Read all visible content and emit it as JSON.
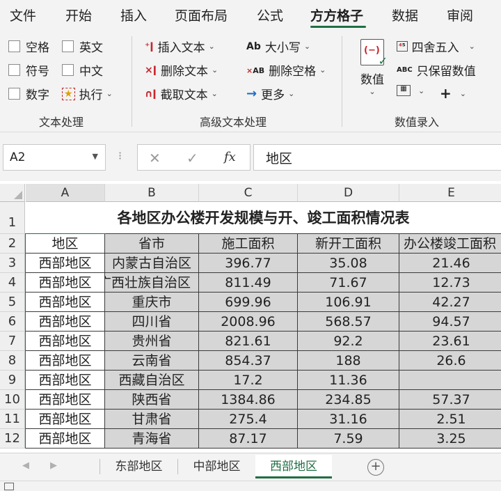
{
  "menu": {
    "tabs": [
      {
        "label": "文件"
      },
      {
        "label": "开始"
      },
      {
        "label": "插入"
      },
      {
        "label": "页面布局"
      },
      {
        "label": "公式"
      },
      {
        "label": "方方格子"
      },
      {
        "label": "数据"
      },
      {
        "label": "审阅"
      }
    ],
    "active_tab": "方方格子"
  },
  "ribbon": {
    "text_group": {
      "label": "文本处理",
      "space": "空格",
      "english": "英文",
      "symbol": "符号",
      "chinese": "中文",
      "number": "数字",
      "execute": "执行"
    },
    "adv_group": {
      "label": "高级文本处理",
      "insert_text": "插入文本",
      "delete_text": "删除文本",
      "extract_text": "截取文本",
      "case": "大小写",
      "delete_space": "删除空格",
      "more": "更多",
      "case_icon": "Ab",
      "delete_space_icon": "AB"
    },
    "value_group": {
      "label": "数值录入",
      "value_button": "数值",
      "round": "四舍五入",
      "keep_value": "只保留数值",
      "keep_value_icon": "ABC",
      "plus": "+"
    }
  },
  "formula_bar": {
    "name_box": "A2",
    "content": "地区",
    "fx": "fx"
  },
  "sheet": {
    "columns": [
      "A",
      "B",
      "C",
      "D",
      "E"
    ],
    "selected_column": "A",
    "title": "各地区办公楼开发规模与开、竣工面积情况表",
    "headers": [
      "地区",
      "省市",
      "施工面积",
      "新开工面积",
      "办公楼竣工面积"
    ],
    "rows": [
      {
        "num": "3",
        "cells": [
          "西部地区",
          "内蒙古自治区",
          "396.77",
          "35.08",
          "21.46"
        ]
      },
      {
        "num": "4",
        "cells": [
          "西部地区",
          "广西壮族自治区",
          "811.49",
          "71.67",
          "12.73"
        ]
      },
      {
        "num": "5",
        "cells": [
          "西部地区",
          "重庆市",
          "699.96",
          "106.91",
          "42.27"
        ]
      },
      {
        "num": "6",
        "cells": [
          "西部地区",
          "四川省",
          "2008.96",
          "568.57",
          "94.57"
        ]
      },
      {
        "num": "7",
        "cells": [
          "西部地区",
          "贵州省",
          "821.61",
          "92.2",
          "23.61"
        ]
      },
      {
        "num": "8",
        "cells": [
          "西部地区",
          "云南省",
          "854.37",
          "188",
          "26.6"
        ]
      },
      {
        "num": "9",
        "cells": [
          "西部地区",
          "西藏自治区",
          "17.2",
          "11.36",
          ""
        ]
      },
      {
        "num": "10",
        "cells": [
          "西部地区",
          "陕西省",
          "1384.86",
          "234.85",
          "57.37"
        ]
      },
      {
        "num": "11",
        "cells": [
          "西部地区",
          "甘肃省",
          "275.4",
          "31.16",
          "2.51"
        ]
      },
      {
        "num": "12",
        "cells": [
          "西部地区",
          "青海省",
          "87.17",
          "7.59",
          "3.25"
        ]
      }
    ],
    "row_nums_top": [
      "1",
      "2"
    ]
  },
  "sheet_tabs": [
    {
      "label": "东部地区"
    },
    {
      "label": "中部地区"
    },
    {
      "label": "西部地区"
    }
  ],
  "active_sheet": "西部地区",
  "colors": {
    "accent": "#1f6e43",
    "selected_fill": "#d6d6d6",
    "icon_red": "#c8262b"
  }
}
